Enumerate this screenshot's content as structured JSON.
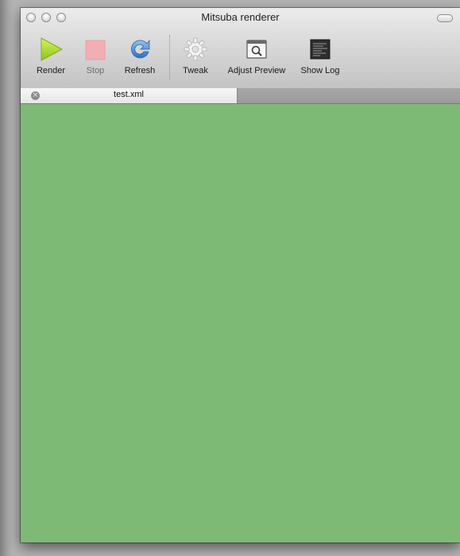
{
  "window": {
    "title": "Mitsuba renderer"
  },
  "toolbar": {
    "items": [
      {
        "label": "Render",
        "icon": "play-icon",
        "enabled": true
      },
      {
        "label": "Stop",
        "icon": "stop-icon",
        "enabled": false
      },
      {
        "label": "Refresh",
        "icon": "refresh-icon",
        "enabled": true
      },
      {
        "label": "Tweak",
        "icon": "gear-icon",
        "enabled": true
      },
      {
        "label": "Adjust Preview",
        "icon": "magnifier-window-icon",
        "enabled": true
      },
      {
        "label": "Show Log",
        "icon": "log-console-icon",
        "enabled": true
      }
    ]
  },
  "tabs": [
    {
      "label": "test.xml",
      "active": true
    }
  ],
  "canvas": {
    "color": "#7dba75"
  },
  "colors": {
    "render_green": "#a7d42a",
    "stop_pink": "#f2aeb3",
    "refresh_blue": "#3e86d6"
  }
}
